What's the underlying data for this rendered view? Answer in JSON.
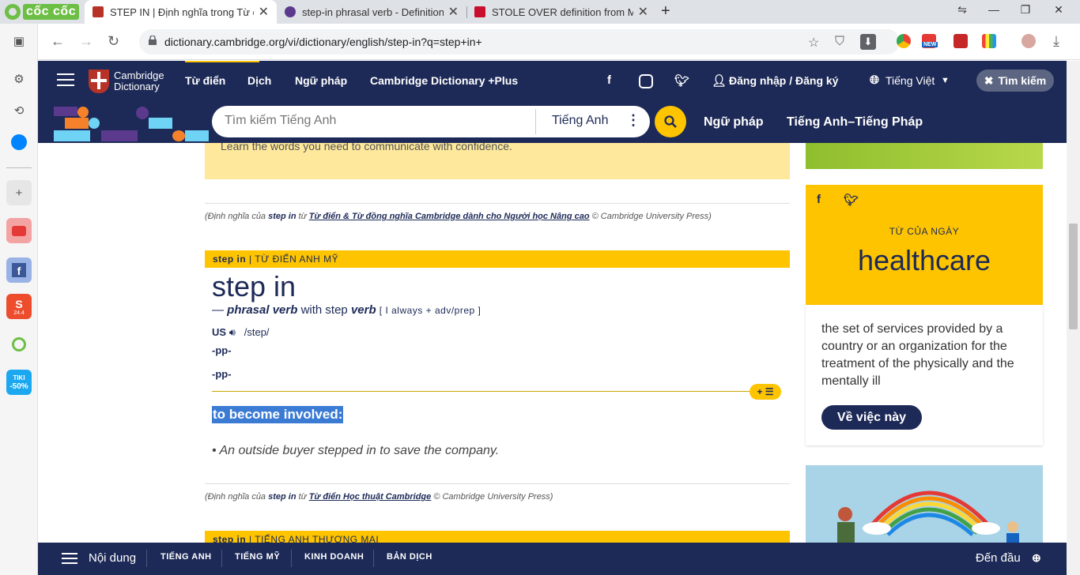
{
  "browser": {
    "logo_text": "cốc cốc",
    "tabs": [
      {
        "title": "STEP IN | Định nghĩa trong Từ điển tiếng Anh Cambridge",
        "active": true,
        "favicon_color": "#b73328"
      },
      {
        "title": "step-in phrasal verb - Definition",
        "active": false,
        "favicon_color": "#5b3a8e"
      },
      {
        "title": "STOLE OVER definition from Macmillan",
        "active": false,
        "favicon_color": "#c8102e"
      }
    ],
    "new_tab": "+",
    "url": "dictionary.cambridge.org/vi/dictionary/english/step-in?q=step+in+",
    "ext_badge": "NEW"
  },
  "sidebar": {
    "shopee_badge": "24.4",
    "tiki_label": "TIKI",
    "tiki_badge": "-50%"
  },
  "cambridge": {
    "logo_line1": "Cambridge",
    "logo_line2": "Dictionary",
    "nav": [
      "Từ điển",
      "Dịch",
      "Ngữ pháp",
      "Cambridge Dictionary +Plus"
    ],
    "login": "Đăng nhập / Đăng ký",
    "language": "Tiếng Việt",
    "search_top": "Tìm kiếm",
    "search_placeholder": "Tìm kiếm Tiếng Anh",
    "search_lang": "Tiếng Anh",
    "sublinks": [
      "Ngữ pháp",
      "Tiếng Anh–Tiếng Pháp"
    ]
  },
  "entry": {
    "promo_text": "Learn the words you need to communicate with confidence.",
    "credit1_prefix": "(Định nghĩa của",
    "credit1_word": "step in",
    "credit1_mid": "từ",
    "credit1_source": "Từ điển & Từ đồng nghĩa Cambridge dành cho Người học Nâng cao",
    "credit1_suffix": "© Cambridge University Press)",
    "dict_headword": "step in",
    "dict_label": "| TỪ ĐIỂN ANH MỸ",
    "headword": "step in",
    "pos_dash": "—",
    "pos": "phrasal verb",
    "pos_with": "with step",
    "pos_verb": "verb",
    "grammar": "[ I always + adv/prep ]",
    "region": "US",
    "ipa": "/step/",
    "form1": "-pp-",
    "form2": "-pp-",
    "toggle": "+ ☰",
    "definition": "to become involved:",
    "example_bullet": "•",
    "example": "An outside buyer stepped in to save the company.",
    "credit2_prefix": "(Định nghĩa của",
    "credit2_word": "step in",
    "credit2_mid": "từ",
    "credit2_source": "Từ điển Học thuật Cambridge",
    "credit2_suffix": "© Cambridge University Press)",
    "dict3_headword": "step in",
    "dict3_label": "| TIẾNG ANH THƯƠNG MẠI"
  },
  "word_of_day": {
    "label": "TỪ CỦA NGÀY",
    "word": "healthcare",
    "definition": "the set of services provided by a country or an organization for the treatment of the physically and the mentally ill",
    "button": "Về việc này"
  },
  "bottom": {
    "menu": "Nội dung",
    "items": [
      "TIẾNG ANH",
      "TIẾNG MỸ",
      "KINH DOANH",
      "BẢN DỊCH"
    ],
    "top": "Đến đầu"
  },
  "colors": {
    "navy": "#1d2a57",
    "yellow": "#fec400",
    "highlight": "#3b7bd4"
  }
}
